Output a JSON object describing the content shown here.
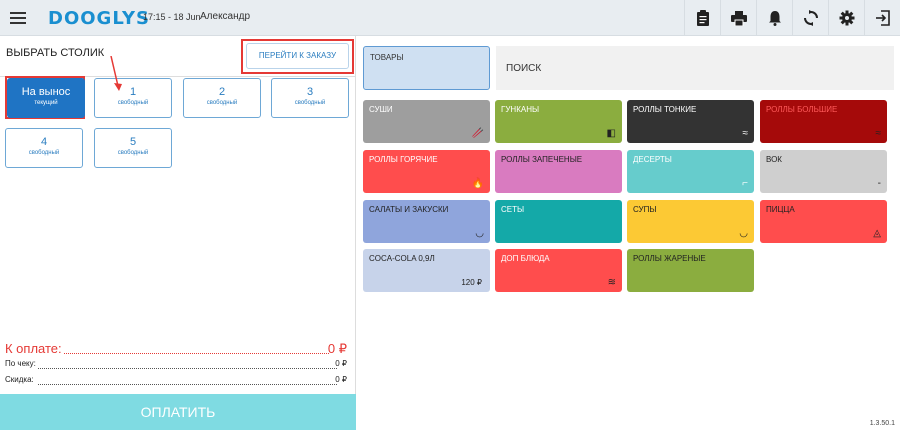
{
  "topbar": {
    "logo": "DOOGLYS",
    "datetime": "17:15 - 18 Jun",
    "username": "Александр",
    "icons": [
      "clipboard-icon",
      "printer-icon",
      "bell-icon",
      "sync-icon",
      "gear-icon",
      "logout-icon"
    ]
  },
  "left": {
    "title": "ВЫБРАТЬ СТОЛИК",
    "goto_order": "ПЕРЕЙТИ К ЗАКАЗУ",
    "tables": [
      {
        "label": "На вынос",
        "status": "текущий",
        "active": true
      },
      {
        "label": "1",
        "status": "свободный"
      },
      {
        "label": "2",
        "status": "свободный"
      },
      {
        "label": "3",
        "status": "свободный"
      },
      {
        "label": "4",
        "status": "свободный"
      },
      {
        "label": "5",
        "status": "свободный"
      }
    ],
    "to_pay_label": "К оплате:",
    "to_pay_value": "0 ₽",
    "by_check_label": "По чеку:",
    "by_check_value": "0 ₽",
    "discount_label": "Скидка:",
    "discount_value": "0 ₽",
    "pay_button": "ОПЛАТИТЬ"
  },
  "right": {
    "goods": "ТОВАРЫ",
    "search_placeholder": "ПОИСК",
    "categories": [
      {
        "name": "СУШИ",
        "color": "#9e9e9e",
        "icon": "chopsticks-icon"
      },
      {
        "name": "ГУНКАНЫ",
        "color": "#8bad3f",
        "icon": "gunkan-icon"
      },
      {
        "name": "РОЛЛЫ ТОНКИЕ",
        "color": "#333333",
        "icon": "rolls-icon"
      },
      {
        "name": "РОЛЛЫ БОЛЬШИЕ",
        "color": "#a50a0a",
        "icon": "rolls-icon"
      },
      {
        "name": "РОЛЛЫ ГОРЯЧИЕ",
        "color": "#ff4d4d",
        "icon": "fire-icon"
      },
      {
        "name": "РОЛЛЫ ЗАПЕЧЕНЫЕ",
        "color": "#d97bc0",
        "icon": ""
      },
      {
        "name": "ДЕСЕРТЫ",
        "color": "#66cccc",
        "icon": "dessert-icon"
      },
      {
        "name": "ВОК",
        "color": "#cfcfcf",
        "icon": "wok-icon",
        "dark": true
      },
      {
        "name": "САЛАТЫ И ЗАКУСКИ",
        "color": "#8fa5dc",
        "icon": "bowl-icon"
      },
      {
        "name": "СЕТЫ",
        "color": "#14a9a8",
        "icon": ""
      },
      {
        "name": "СУПЫ",
        "color": "#fcc934",
        "icon": "soup-icon"
      },
      {
        "name": "ПИЦЦА",
        "color": "#ff4d4d",
        "icon": "pizza-icon"
      },
      {
        "name": "COCA-COLA 0,9Л",
        "color": "#c7d3ea",
        "icon": "",
        "price": "120 ₽",
        "dark": true
      },
      {
        "name": "ДОП БЛЮДА",
        "color": "#ff4d4d",
        "icon": "waves-icon"
      },
      {
        "name": "РОЛЛЫ ЖАРЕНЫЕ",
        "color": "#8bad3f",
        "icon": ""
      }
    ]
  },
  "version": "1.3.50.1"
}
